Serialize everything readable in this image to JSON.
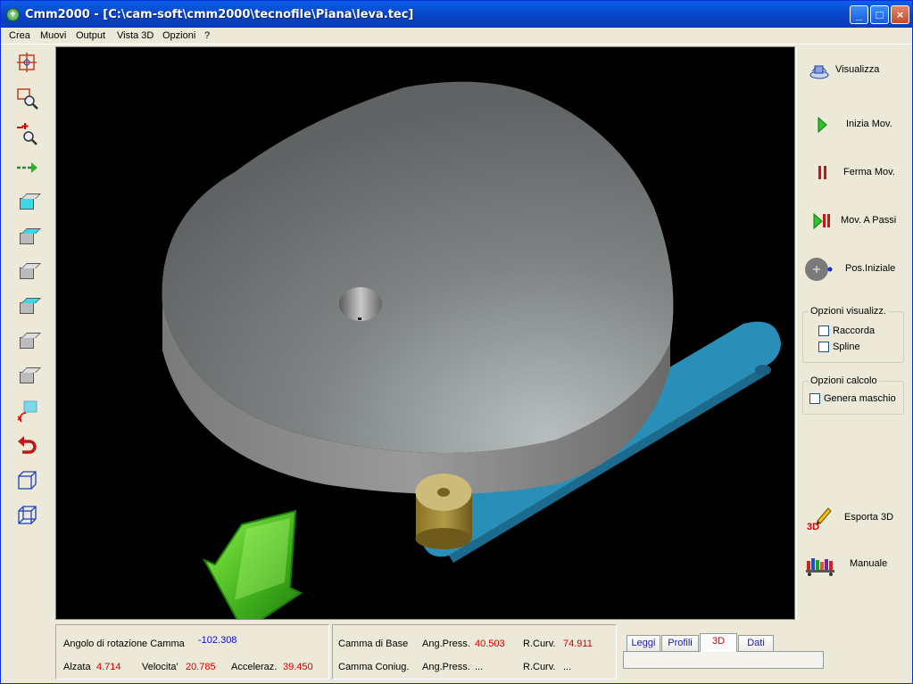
{
  "window": {
    "title": "Cmm2000 - [C:\\cam-soft\\cmm2000\\tecnofile\\Piana\\leva.tec]",
    "app_icon": "+",
    "minimize": "_",
    "maximize": "□",
    "close": "×"
  },
  "menu": [
    "Crea",
    "Muovi",
    "Output",
    "Vista 3D",
    "Opzioni",
    "?"
  ],
  "left_toolbar_icons": [
    "center-view-icon",
    "zoom-window-icon",
    "zoom-out-icon",
    "pan-icon",
    "cube-front-icon",
    "cube-right-icon",
    "cube-left-icon",
    "cube-top-icon",
    "cube-iso-icon",
    "cube-back-icon",
    "rotate-axes-icon",
    "undo-arrow-icon",
    "wireframe-cube-icon",
    "wireframe-box-icon"
  ],
  "right_panel": {
    "buttons": [
      {
        "label": "Visualizza",
        "icon": "view-3d-icon"
      },
      {
        "label": "Inizia Mov.",
        "icon": "play-icon"
      },
      {
        "label": "Ferma Mov.",
        "icon": "pause-icon"
      },
      {
        "label": "Mov. A Passi",
        "icon": "step-icon"
      },
      {
        "label": "Pos.Iniziale",
        "icon": "home-position-icon"
      }
    ],
    "opzioni_visualizz": {
      "title": "Opzioni visualizz.",
      "raccorda": "Raccorda",
      "spline": "Spline"
    },
    "opzioni_calcolo": {
      "title": "Opzioni calcolo",
      "genera_maschio": "Genera maschio"
    },
    "esporta": {
      "label": "Esporta 3D",
      "icon_text": "3D"
    },
    "manuale": {
      "label": "Manuale"
    }
  },
  "status": {
    "angolo_label": "Angolo di rotazione Camma",
    "angolo_value": "-102.308",
    "alzata_label": "Alzata",
    "alzata_value": "4.714",
    "velocita_label": "Velocita'",
    "velocita_value": "20.785",
    "acceleraz_label": "Acceleraz.",
    "acceleraz_value": "39.450",
    "camma_base_label": "Camma di Base",
    "camma_coniug_label": "Camma Coniug.",
    "ang_press_label": "Ang.Press.",
    "ang_press_base": "40.503",
    "ang_press_coniug": "...",
    "r_curv_label": "R.Curv.",
    "r_curv_base": "74.911",
    "r_curv_coniug": "..."
  },
  "tabs": [
    "Leggi",
    "Profili",
    "3D",
    "Dati"
  ],
  "active_tab": "3D",
  "colors": {
    "cam": "#8a8c8c",
    "lever": "#2a8fb8",
    "roller": "#a08a3a",
    "arrow": "#3fae1c"
  }
}
